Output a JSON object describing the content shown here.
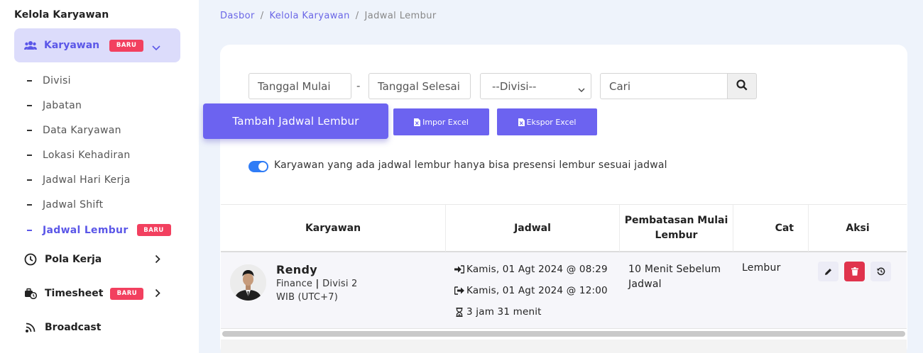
{
  "sidebar": {
    "section_title": "Kelola Karyawan",
    "active_item": {
      "label": "Karyawan",
      "badge": "BARU",
      "icon": "users-icon"
    },
    "sub_items": [
      {
        "label": "Divisi",
        "active": false
      },
      {
        "label": "Jabatan",
        "active": false
      },
      {
        "label": "Data Karyawan",
        "active": false
      },
      {
        "label": "Lokasi Kehadiran",
        "active": false
      },
      {
        "label": "Jadwal Hari Kerja",
        "active": false
      },
      {
        "label": "Jadwal Shift",
        "active": false
      },
      {
        "label": "Jadwal Lembur",
        "active": true,
        "badge": "BARU"
      }
    ],
    "main_items": [
      {
        "label": "Pola Kerja",
        "icon": "clock-icon"
      },
      {
        "label": "Timesheet",
        "icon": "timesheet-icon",
        "badge": "BARU"
      },
      {
        "label": "Broadcast",
        "icon": "broadcast-icon"
      }
    ]
  },
  "breadcrumb": [
    "Dasbor",
    "Kelola Karyawan",
    "Jadwal Lembur"
  ],
  "filters": {
    "start_date_placeholder": "Tanggal Mulai",
    "date_separator": "-",
    "end_date_placeholder": "Tanggal Selesai",
    "division_value": "--Divisi--",
    "search_placeholder": "Cari"
  },
  "actions": {
    "add_label": "Tambah Jadwal Lembur",
    "import_label": "Impor Excel",
    "export_label": "Ekspor Excel"
  },
  "toggle": {
    "enabled": true,
    "label": "Karyawan yang ada jadwal lembur hanya bisa presensi lembur sesuai jadwal"
  },
  "table": {
    "headers": {
      "employee": "Karyawan",
      "schedule": "Jadwal",
      "limit_l1": "Pembatasan Mulai",
      "limit_l2": "Lembur",
      "note": "Cat",
      "actions": "Aksi"
    },
    "rows": [
      {
        "name": "Rendy",
        "dept": "Finance",
        "division": "Divisi 2",
        "timezone": "WIB (UTC+7)",
        "start": "Kamis, 01 Agt 2024 @ 08:29",
        "end": "Kamis, 01 Agt 2024 @ 12:00",
        "duration": "3 jam 31 menit",
        "limit_l1": "10 Menit Sebelum",
        "limit_l2": "Jadwal",
        "note": "Lembur"
      }
    ]
  },
  "colors": {
    "accent": "#6c63f0",
    "badge": "#f2405f",
    "toggle": "#2f7cf6",
    "delete": "#e0344d"
  }
}
